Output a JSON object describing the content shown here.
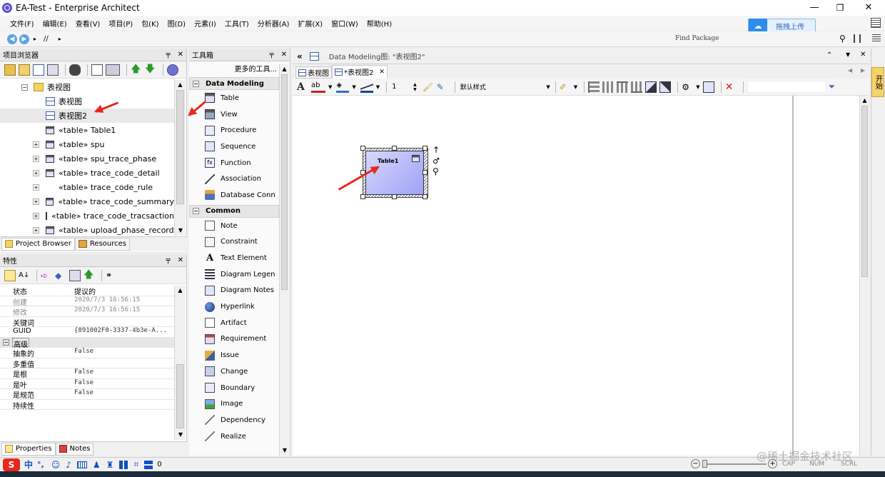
{
  "window": {
    "title": "EA-Test - Enterprise Architect"
  },
  "menu": [
    "文件(F)",
    "编辑(E)",
    "查看(V)",
    "项目(P)",
    "包(K)",
    "图(D)",
    "元素(I)",
    "工具(T)",
    "分析器(A)",
    "扩展(X)",
    "窗口(W)",
    "帮助(H)"
  ],
  "cloud_upload": {
    "label": "拖拽上传"
  },
  "nav": {
    "path": "//",
    "find_package": "Find Package"
  },
  "project_browser": {
    "title": "项目浏览器",
    "root": "表视图",
    "diagrams": [
      "表视图",
      "表视图2"
    ],
    "tables": [
      "«table» Table1",
      "«table» spu",
      "«table» spu_trace_phase",
      "«table» trace_code_detail",
      "«table» trace_code_rule",
      "«table» trace_code_summary",
      "«table» trace_code_tracsaction",
      "«table» upload_phase_record"
    ],
    "tabs": [
      "Project Browser",
      "Resources"
    ]
  },
  "properties": {
    "title": "特性",
    "rows": [
      {
        "k": "状态",
        "v": "提议的"
      },
      {
        "k": "创建",
        "v": "2020/7/3 16:56:15"
      },
      {
        "k": "修改",
        "v": "2020/7/3 16:56:15"
      },
      {
        "k": "关键词",
        "v": ""
      },
      {
        "k": "GUID",
        "v": "{891002F0-3337-4b3e-A..."
      }
    ],
    "advanced_label": "高级",
    "adv_rows": [
      {
        "k": "抽象的",
        "v": "False"
      },
      {
        "k": "多重值",
        "v": ""
      },
      {
        "k": "是根",
        "v": "False"
      },
      {
        "k": "是叶",
        "v": "False"
      },
      {
        "k": "是规范",
        "v": "False"
      },
      {
        "k": "持续性",
        "v": ""
      }
    ],
    "tabs": [
      "Properties",
      "Notes"
    ]
  },
  "toolbox": {
    "title": "工具箱",
    "more_tools": "更多的工具...",
    "groups": [
      {
        "name": "Data Modeling",
        "items": [
          "Table",
          "View",
          "Procedure",
          "Sequence",
          "Function",
          "Association",
          "Database Conn"
        ]
      },
      {
        "name": "Common",
        "items": [
          "Note",
          "Constraint",
          "Text Element",
          "Diagram Legen",
          "Diagram Notes",
          "Hyperlink",
          "Artifact",
          "Requirement",
          "Issue",
          "Change",
          "Boundary",
          "Image",
          "Dependency",
          "Realize"
        ]
      }
    ]
  },
  "diagram": {
    "header": "Data Modeling图: \"表视图2\"",
    "tabs": [
      "表视图",
      "*表视图2"
    ],
    "line_width": "1",
    "style": "默认样式",
    "element_label": "Table1"
  },
  "side_tab": "开始",
  "statusbar": {
    "value": "0",
    "indicators": [
      "CAP",
      "NUM",
      "SCRL"
    ],
    "watermark": "@稀土掘金技术社区",
    "ime": [
      "中",
      "°,"
    ]
  },
  "colors": {
    "accent": "#2d8cf0",
    "arrow": "#e8291c",
    "element_fill": "#b4b8ff"
  }
}
